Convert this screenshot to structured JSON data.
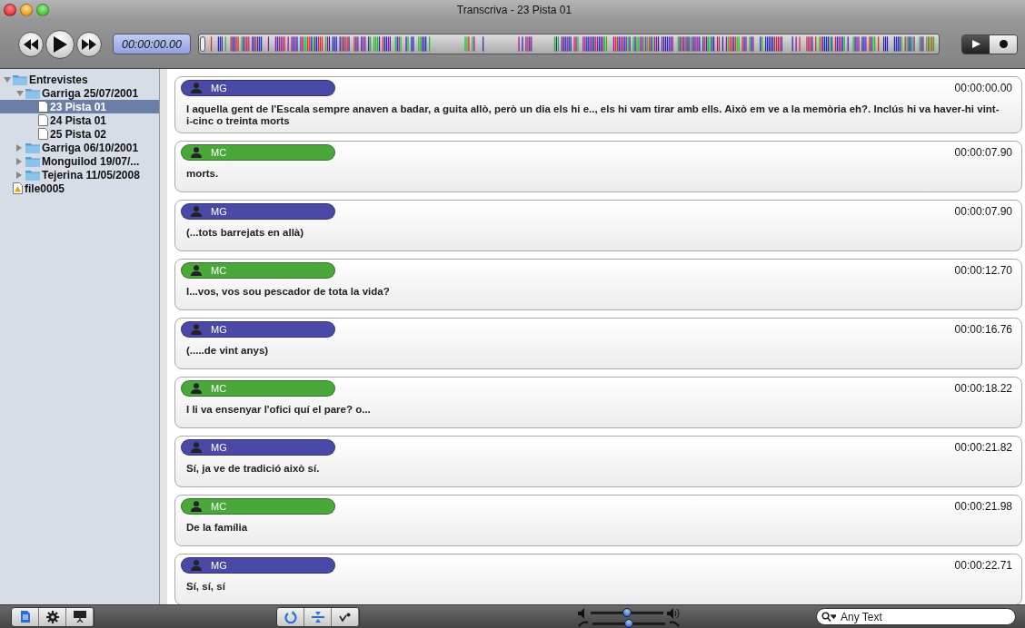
{
  "window": {
    "title": "Transcriva - 23 Pista 01"
  },
  "toolbar": {
    "time": "00:00:00.00",
    "modes": [
      {
        "kind": "play",
        "selected": true
      },
      {
        "kind": "record",
        "selected": false
      }
    ]
  },
  "sidebar": {
    "items": [
      {
        "kind": "folder",
        "label": "Entrevistes",
        "expanded": true,
        "selected": false,
        "children": [
          {
            "kind": "folder",
            "label": "Garriga 25/07/2001",
            "expanded": true,
            "selected": false,
            "children": [
              {
                "kind": "file",
                "label": "23 Pista 01",
                "selected": true
              },
              {
                "kind": "file",
                "label": "24 Pista 01",
                "selected": false
              },
              {
                "kind": "file",
                "label": "25 Pista 02",
                "selected": false
              }
            ]
          },
          {
            "kind": "folder",
            "label": "Garriga 06/10/2001",
            "expanded": false,
            "selected": false
          },
          {
            "kind": "folder",
            "label": "Monguilod 19/07/...",
            "expanded": false,
            "selected": false
          },
          {
            "kind": "folder",
            "label": "Tejerina 11/05/2008",
            "expanded": false,
            "selected": false
          }
        ]
      },
      {
        "kind": "media",
        "label": "file0005",
        "selected": false
      }
    ]
  },
  "entries": [
    {
      "speaker": "MG",
      "color": "#4a4aa6",
      "time": "00:00:00.00",
      "text": "I aquella gent de l'Escala sempre anaven a badar, a guita allò, però un dia els hi e.., els hi vam tirar amb ells. Això em ve a la memòria eh?. Inclús hi va haver-hi vint-i-cinc o treinta morts"
    },
    {
      "speaker": "MC",
      "color": "#4aa83a",
      "time": "00:00:07.90",
      "text": "morts."
    },
    {
      "speaker": "MG",
      "color": "#4a4aa6",
      "time": "00:00:07.90",
      "text": "(...tots barrejats en allà)"
    },
    {
      "speaker": "MC",
      "color": "#4aa83a",
      "time": "00:00:12.70",
      "text": "I...vos, vos sou pescador de tota la vida?"
    },
    {
      "speaker": "MG",
      "color": "#4a4aa6",
      "time": "00:00:16.76",
      "text": "(.....de vint anys)"
    },
    {
      "speaker": "MC",
      "color": "#4aa83a",
      "time": "00:00:18.22",
      "text": "I li va ensenyar l'ofici quí el pare? o..."
    },
    {
      "speaker": "MG",
      "color": "#4a4aa6",
      "time": "00:00:21.82",
      "text": "Sí, ja ve de tradició això sí."
    },
    {
      "speaker": "MC",
      "color": "#4aa83a",
      "time": "00:00:21.98",
      "text": "De la família"
    },
    {
      "speaker": "MG",
      "color": "#4a4aa6",
      "time": "00:00:22.71",
      "text": "Sí, sí, sí"
    }
  ],
  "bottom_bar": {
    "left_buttons": [
      {
        "kind": "document",
        "on": true
      },
      {
        "kind": "gear",
        "on": false
      },
      {
        "kind": "presentation",
        "on": false
      }
    ],
    "center_buttons": [
      {
        "kind": "loop",
        "on": true
      },
      {
        "kind": "split",
        "on": true
      },
      {
        "kind": "pitch",
        "on": false
      }
    ],
    "volume": {
      "level": 0.5
    },
    "speed": {
      "level": 0.5
    },
    "search": {
      "placeholder": "Any Text"
    }
  }
}
